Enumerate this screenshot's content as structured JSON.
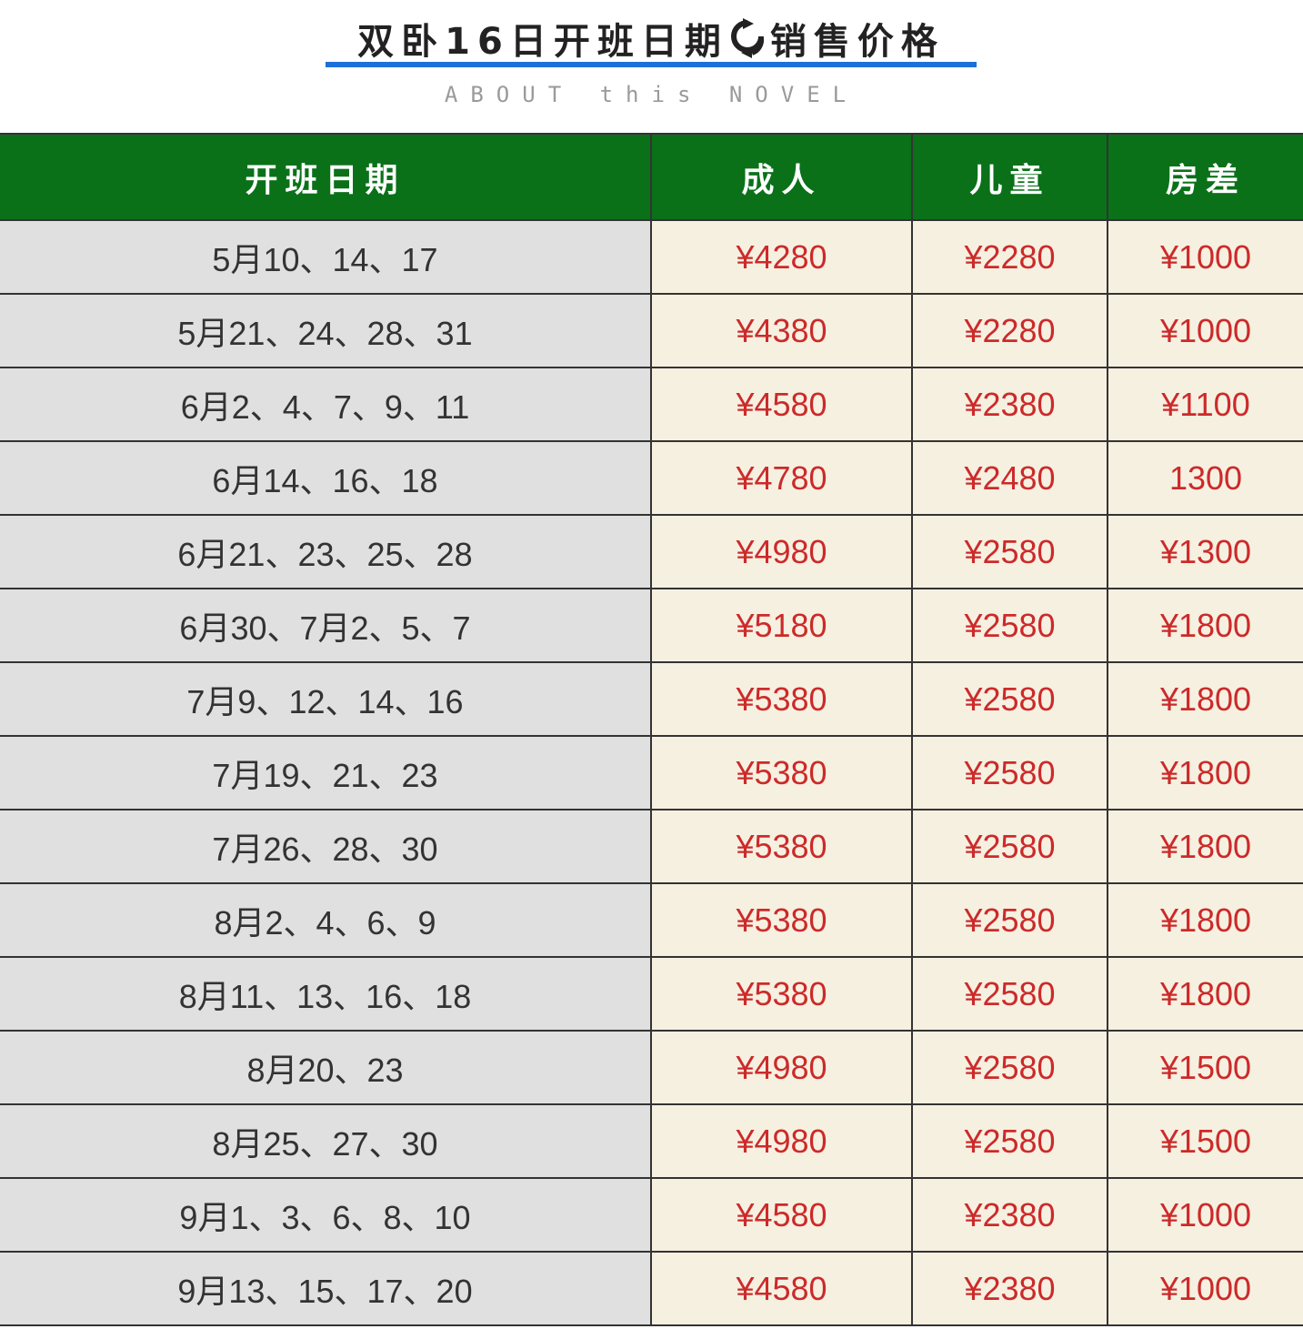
{
  "header": {
    "title_left": "双卧16日开班日期",
    "title_right": "销售价格",
    "subtitle": "ABOUT this NOVEL",
    "icon": "refresh-icon",
    "accent_color": "#1e6fd9",
    "subtitle_color": "#9a9a9a"
  },
  "table": {
    "header_color": "#0a7119",
    "price_color": "#cc2a2a",
    "columns": [
      "开班日期",
      "成人",
      "儿童",
      "房差"
    ],
    "rows": [
      [
        "5月10、14、17",
        "¥4280",
        "¥2280",
        "¥1000"
      ],
      [
        "5月21、24、28、31",
        "¥4380",
        "¥2280",
        "¥1000"
      ],
      [
        "6月2、4、7、9、11",
        "¥4580",
        "¥2380",
        "¥1100"
      ],
      [
        "6月14、16、18",
        "¥4780",
        "¥2480",
        "1300"
      ],
      [
        "6月21、23、25、28",
        "¥4980",
        "¥2580",
        "¥1300"
      ],
      [
        "6月30、7月2、5、7",
        "¥5180",
        "¥2580",
        "¥1800"
      ],
      [
        "7月9、12、14、16",
        "¥5380",
        "¥2580",
        "¥1800"
      ],
      [
        "7月19、21、23",
        "¥5380",
        "¥2580",
        "¥1800"
      ],
      [
        "7月26、28、30",
        "¥5380",
        "¥2580",
        "¥1800"
      ],
      [
        "8月2、4、6、9",
        "¥5380",
        "¥2580",
        "¥1800"
      ],
      [
        "8月11、13、16、18",
        "¥5380",
        "¥2580",
        "¥1800"
      ],
      [
        "8月20、23",
        "¥4980",
        "¥2580",
        "¥1500"
      ],
      [
        "8月25、27、30",
        "¥4980",
        "¥2580",
        "¥1500"
      ],
      [
        "9月1、3、6、8、10",
        "¥4580",
        "¥2380",
        "¥1000"
      ],
      [
        "9月13、15、17、20",
        "¥4580",
        "¥2380",
        "¥1000"
      ]
    ]
  }
}
